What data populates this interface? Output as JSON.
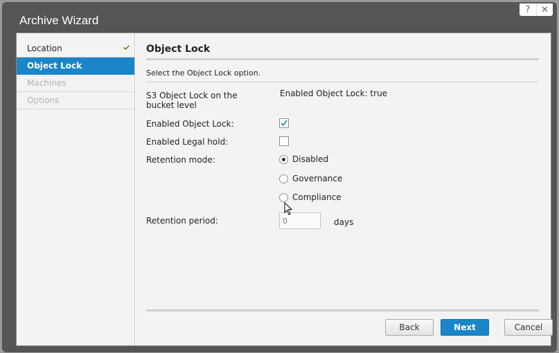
{
  "window": {
    "title": "Archive Wizard",
    "help_label": "?",
    "close_label": "✕"
  },
  "sidebar": {
    "items": [
      {
        "label": "Location",
        "state": "completed"
      },
      {
        "label": "Object Lock",
        "state": "active"
      },
      {
        "label": "Machines",
        "state": "disabled"
      },
      {
        "label": "Options",
        "state": "disabled"
      }
    ]
  },
  "page": {
    "title": "Object Lock",
    "description": "Select the Object Lock option.",
    "bucket_lock_label": "S3 Object Lock on the bucket level",
    "bucket_lock_value": "Enabled Object Lock: true",
    "enabled_object_lock_label": "Enabled Object Lock:",
    "enabled_object_lock_checked": true,
    "enabled_legal_hold_label": "Enabled Legal hold:",
    "enabled_legal_hold_checked": false,
    "retention_mode_label": "Retention mode:",
    "retention_modes": [
      "Disabled",
      "Governance",
      "Compliance"
    ],
    "retention_mode_selected": "Disabled",
    "retention_period_label": "Retention period:",
    "retention_period_placeholder": "0",
    "retention_period_unit": "days"
  },
  "footer": {
    "back_label": "Back",
    "next_label": "Next",
    "cancel_label": "Cancel"
  },
  "colors": {
    "accent": "#1a86c8",
    "check": "#5a9a2a",
    "frame": "#555555"
  }
}
